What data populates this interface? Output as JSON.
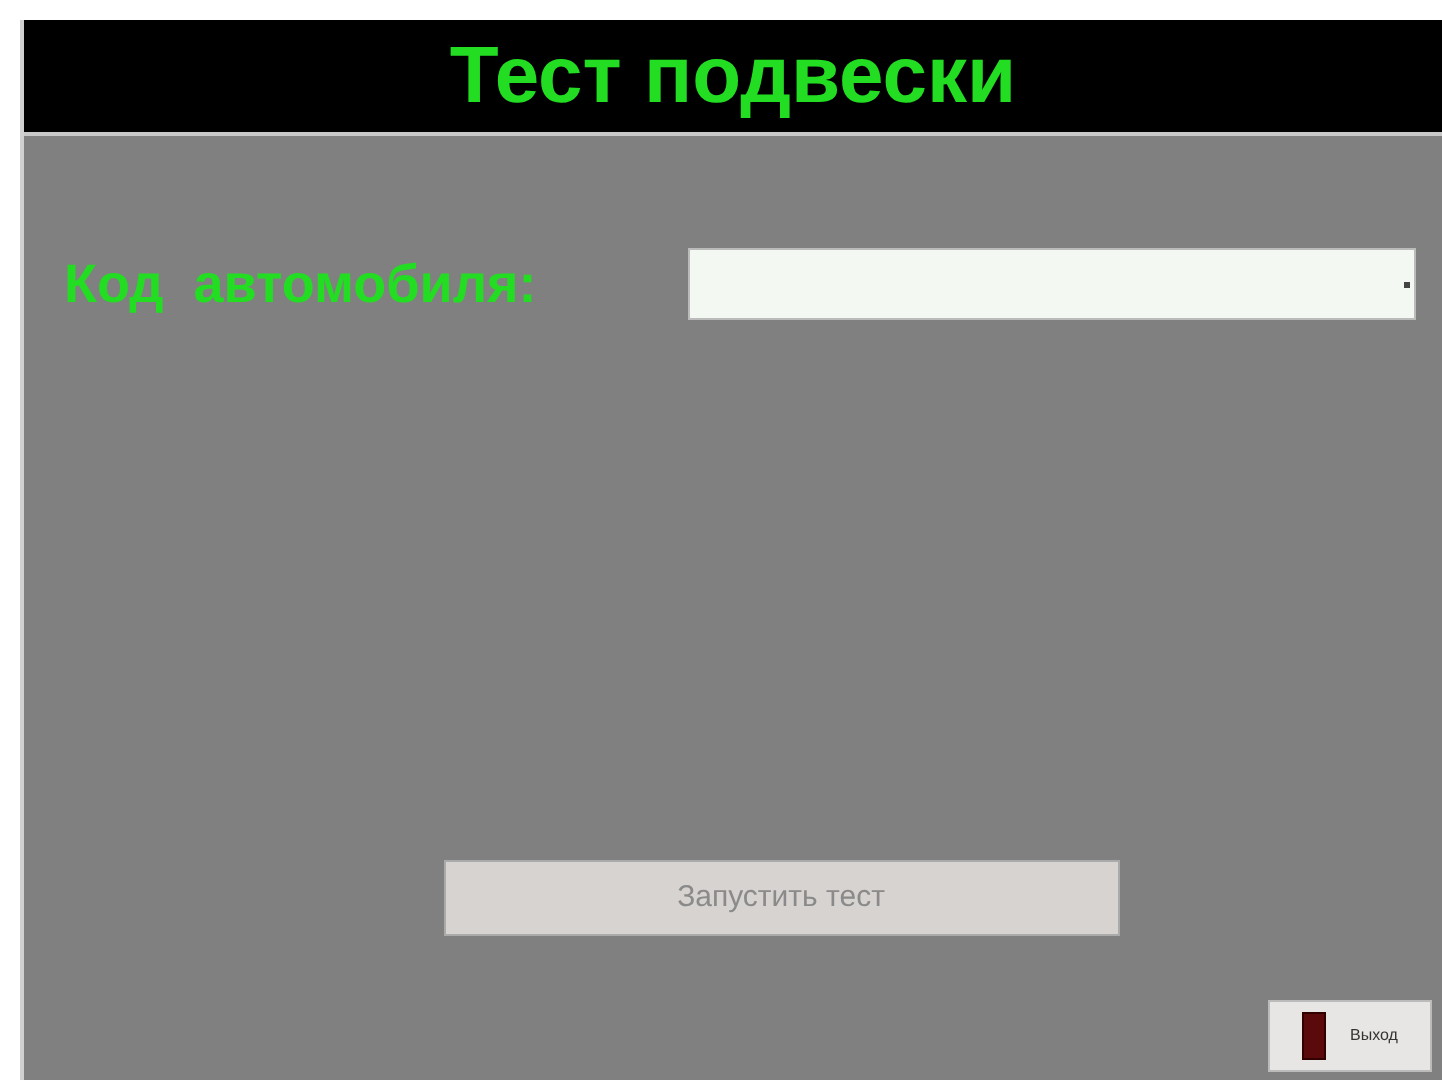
{
  "header": {
    "title": "Тест подвески"
  },
  "car_code": {
    "label": "Код  автомобиля:"
  },
  "start_button": {
    "label": "Запустить тест",
    "disabled": true
  },
  "exit_button": {
    "label": "Выход"
  }
}
